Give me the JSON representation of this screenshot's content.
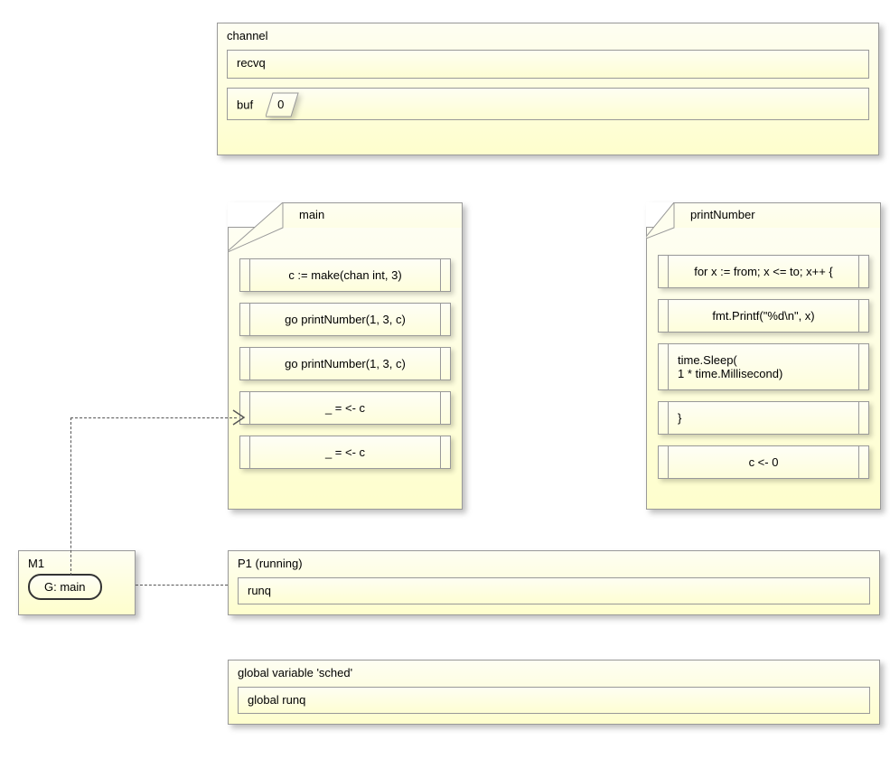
{
  "channel": {
    "title": "channel",
    "recvq": "recvq",
    "buf_label": "buf",
    "buf_value": "0"
  },
  "main_fn": {
    "title": "main",
    "stmts": [
      "c := make(chan int, 3)",
      "go printNumber(1, 3, c)",
      "go printNumber(1, 3, c)",
      "_ = <- c",
      "_ = <- c"
    ]
  },
  "printNumber_fn": {
    "title": "printNumber",
    "stmts": [
      "for x := from; x <= to; x++ {",
      "fmt.Printf(\"%d\\n\", x)",
      "time.Sleep(\n1 * time.Millisecond)",
      "}",
      "c <- 0"
    ]
  },
  "m1": {
    "title": "M1",
    "g_label": "G: main"
  },
  "p1": {
    "title": "P1 (running)",
    "runq": "runq"
  },
  "sched": {
    "title": "global variable 'sched'",
    "runq": "global runq"
  }
}
